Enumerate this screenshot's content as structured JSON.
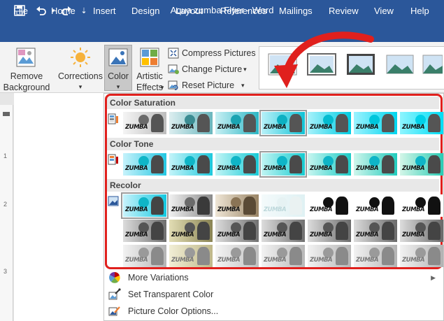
{
  "titlebar": {
    "title": "Aqua zumba Flyer  -  Word",
    "qat": [
      {
        "name": "save-icon",
        "glyph": "💾"
      },
      {
        "name": "undo-icon",
        "glyph": "↶"
      },
      {
        "name": "dropdown-chevron-icon",
        "glyph": "▾"
      },
      {
        "name": "redo-icon",
        "glyph": "↷"
      },
      {
        "name": "customize-qat-icon",
        "glyph": "⇣"
      }
    ]
  },
  "menu": {
    "items": [
      "File",
      "Home",
      "Insert",
      "Design",
      "Layout",
      "References",
      "Mailings",
      "Review",
      "View",
      "Help"
    ]
  },
  "ribbon": {
    "remove_background": "Remove\nBackground",
    "corrections": "Corrections",
    "color": "Color",
    "artistic_effects": "Artistic\nEffects",
    "compress_pictures": "Compress Pictures",
    "change_picture": "Change Picture",
    "reset_picture": "Reset Picture"
  },
  "ruler": {
    "numbers": [
      "1",
      "2",
      "3"
    ]
  },
  "dropdown": {
    "color_saturation": "Color Saturation",
    "color_tone": "Color Tone",
    "recolor": "Recolor",
    "thumb_text": "ZUMBA",
    "more_variations": "More Variations",
    "set_transparent_color": "Set Transparent Color",
    "picture_color_options": "Picture Color Options..."
  },
  "colors": {
    "brand_blue": "#2b579a",
    "highlight_red": "#e0201d"
  }
}
